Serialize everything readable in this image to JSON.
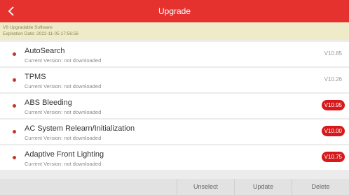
{
  "header": {
    "title": "Upgrade",
    "back_icon": "chevron-left-icon",
    "color": "#e6322f"
  },
  "info": {
    "line1": "V8 Upgradable Software",
    "line2": "Expiration Date: 2022-11-05 17:56:56"
  },
  "items": [
    {
      "name": "AutoSearch",
      "status": "Current Version: not downloaded",
      "version": "V10.85",
      "highlight": false
    },
    {
      "name": "TPMS",
      "status": "Current Version: not downloaded",
      "version": "V10.26",
      "highlight": false
    },
    {
      "name": "ABS Bleeding",
      "status": "Current Version: not downloaded",
      "version": "V10.95",
      "highlight": true
    },
    {
      "name": "AC System Relearn/Initialization",
      "status": "Current Version: not downloaded",
      "version": "V10.00",
      "highlight": true
    },
    {
      "name": "Adaptive Front Lighting",
      "status": "Current Version: not downloaded",
      "version": "V10.75",
      "highlight": true
    }
  ],
  "footer": {
    "unselect": "Unselect",
    "update": "Update",
    "delete": "Delete"
  },
  "colors": {
    "accent": "#e6322f",
    "badge": "#d7191c",
    "info_bg": "#efeac8"
  }
}
